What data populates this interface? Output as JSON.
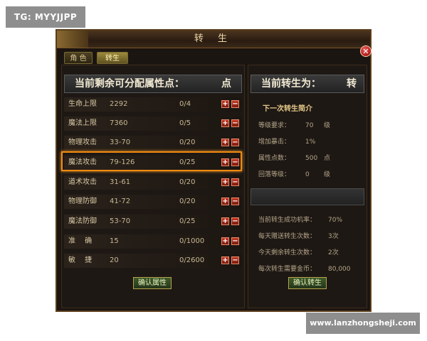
{
  "watermarks": {
    "top_left": "TG: MYYJJPP",
    "bottom_right": "www.lanzhongsheji.com"
  },
  "window": {
    "title": "转 生",
    "close_icon": "close-icon",
    "tabs": [
      {
        "label": "角 色",
        "active": false
      },
      {
        "label": "转生",
        "active": true
      }
    ]
  },
  "left": {
    "header_main": "当前剩余可分配属性点：",
    "header_unit": "点",
    "stats": [
      {
        "name": "生命上限",
        "value": "2292",
        "points": "0/4"
      },
      {
        "name": "魔法上限",
        "value": "7360",
        "points": "0/5"
      },
      {
        "name": "物理攻击",
        "value": "33-70",
        "points": "0/20"
      },
      {
        "name": "魔法攻击",
        "value": "79-126",
        "points": "0/25"
      },
      {
        "name": "道术攻击",
        "value": "31-61",
        "points": "0/20"
      },
      {
        "name": "物理防御",
        "value": "41-72",
        "points": "0/20"
      },
      {
        "name": "魔法防御",
        "value": "53-70",
        "points": "0/25"
      },
      {
        "name": "准　 确",
        "value": "15",
        "points": "0/1000"
      },
      {
        "name": "敏　 捷",
        "value": "20",
        "points": "0/2600"
      }
    ],
    "plus_label": "+",
    "minus_label": "−",
    "confirm_label": "确认属性"
  },
  "right": {
    "header_main": "当前转生为：",
    "header_unit": "转",
    "info_title": "下一次转生简介",
    "info": [
      {
        "label": "等级要求：",
        "value": "70",
        "unit": "级"
      },
      {
        "label": "增加暴击：",
        "value": "1%",
        "unit": ""
      },
      {
        "label": "属性点数：",
        "value": "500",
        "unit": "点"
      },
      {
        "label": "回落等级：",
        "value": "0",
        "unit": "级"
      }
    ],
    "lower": [
      {
        "label": "当前转生成功机率：",
        "value": "70%"
      },
      {
        "label": "每天赠送转生次数：",
        "value": "3次"
      },
      {
        "label": "今天剩余转生次数：",
        "value": "2次"
      },
      {
        "label": "每次转生需要金币：",
        "value": "80,000"
      }
    ],
    "confirm_label": "确认转生"
  },
  "colors": {
    "highlight": "#f08a10",
    "panel_bg": "#1e1814",
    "accent_gold": "#e6c98a"
  }
}
